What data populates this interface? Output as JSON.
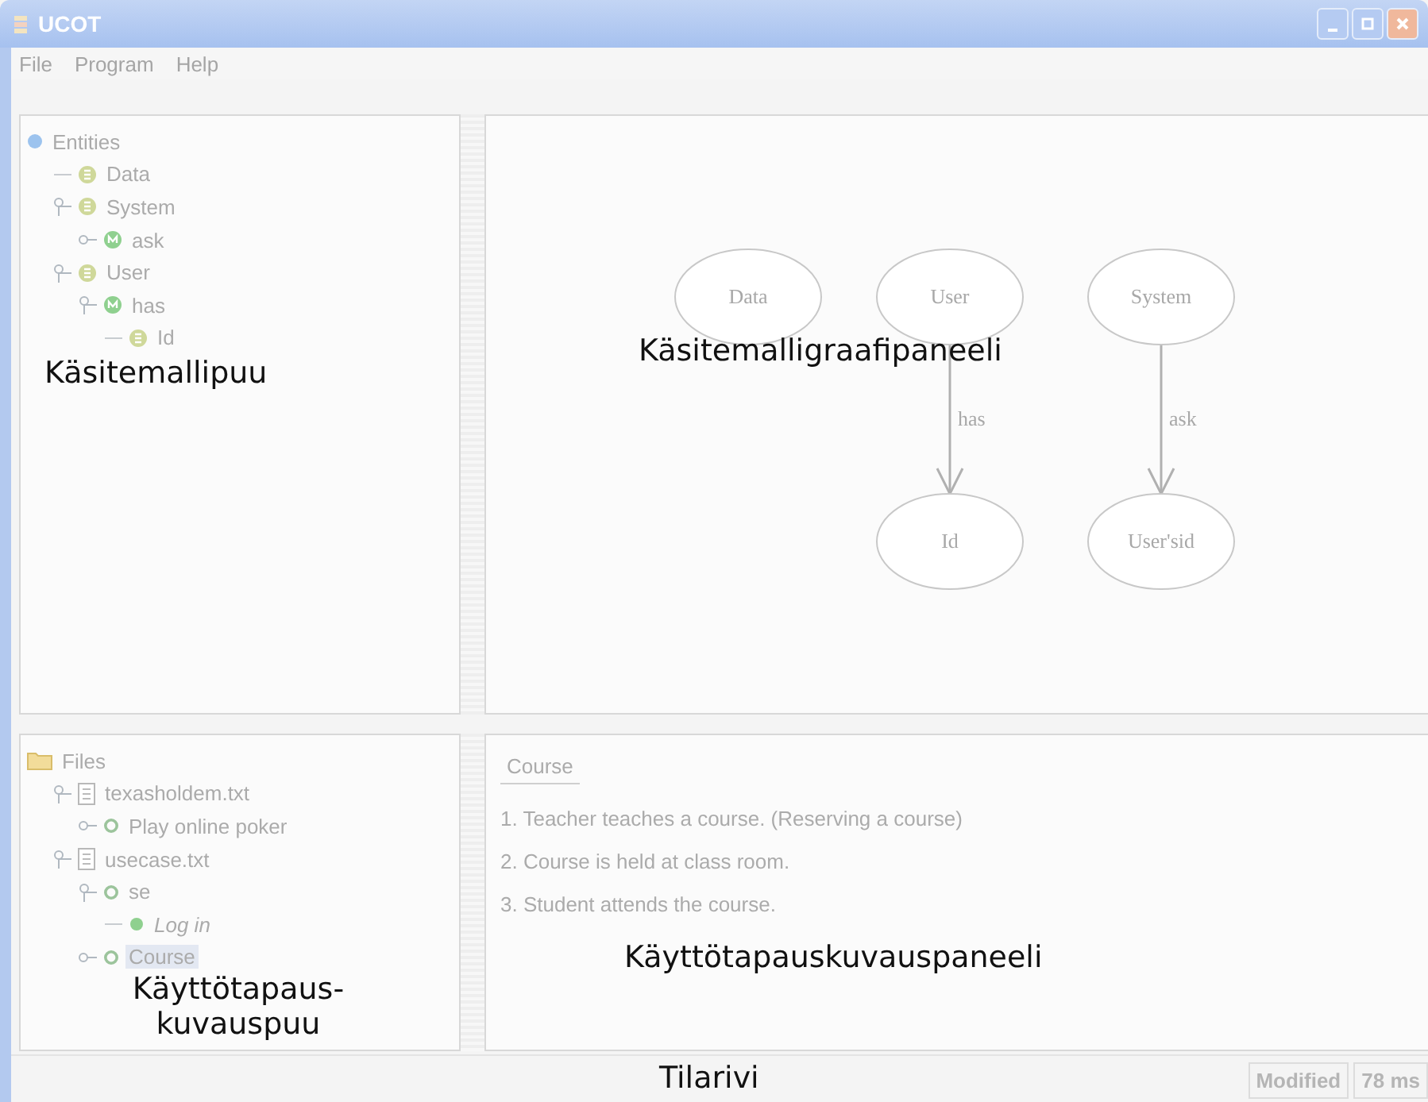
{
  "window": {
    "title": "UCOT"
  },
  "menu": [
    "File",
    "Program",
    "Help"
  ],
  "entity_tree": {
    "label": "Entities",
    "kind": "root",
    "selected": false,
    "children": [
      {
        "label": "Data",
        "kind": "entity",
        "selected": false
      },
      {
        "label": "System",
        "kind": "entity",
        "selected": false,
        "expanded": true,
        "children": [
          {
            "label": "ask",
            "kind": "relation",
            "selected": false,
            "expanded": false
          }
        ]
      },
      {
        "label": "User",
        "kind": "entity",
        "selected": false,
        "expanded": true,
        "children": [
          {
            "label": "has",
            "kind": "relation",
            "selected": false,
            "expanded": true,
            "children": [
              {
                "label": "Id",
                "kind": "entity",
                "selected": false
              }
            ]
          }
        ]
      }
    ]
  },
  "graph": {
    "nodes": [
      {
        "label": "Data"
      },
      {
        "label": "User"
      },
      {
        "label": "System"
      },
      {
        "label": "Id"
      },
      {
        "label": "User'sid"
      }
    ],
    "edges": [
      {
        "label": "has"
      },
      {
        "label": "ask"
      }
    ]
  },
  "file_tree": {
    "label": "Files",
    "kind": "folder",
    "selected": false,
    "children": [
      {
        "label": "texasholdem.txt",
        "kind": "file",
        "selected": false,
        "expanded": true,
        "children": [
          {
            "label": "Play online poker",
            "kind": "usecase",
            "selected": false,
            "expanded": false
          }
        ]
      },
      {
        "label": "usecase.txt",
        "kind": "file",
        "selected": false,
        "expanded": true,
        "children": [
          {
            "label": "se",
            "kind": "usecase",
            "selected": false,
            "expanded": true,
            "children": [
              {
                "label": "Log in",
                "kind": "step",
                "selected": false
              }
            ]
          },
          {
            "label": "Course",
            "kind": "usecase",
            "selected": true,
            "expanded": false
          }
        ]
      }
    ]
  },
  "description": {
    "tabs": [
      {
        "label": "Course",
        "selected": true
      }
    ],
    "lines": [
      "1. Teacher teaches a course.  (Reserving a course)",
      "2. Course is held at class room.",
      "3. Student attends the course."
    ]
  },
  "status_bar": [
    "Modified",
    "78 ms"
  ],
  "annotations": [
    "Käsitemallipuu",
    "Käsitemalligraafipaneeli",
    "Käyttötapaus-kuvauspuu",
    "Käyttötapauskuvauspaneeli",
    "Tilarivi"
  ]
}
